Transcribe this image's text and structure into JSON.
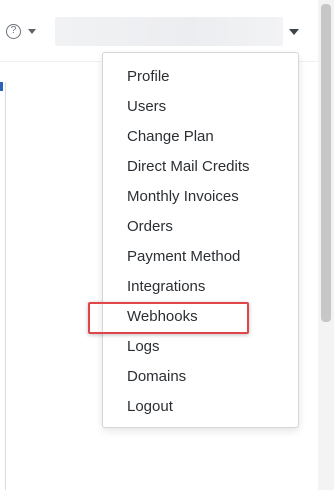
{
  "header": {
    "help": {
      "icon": "help-circle-icon",
      "glyph": "?"
    },
    "account": {
      "name": ""
    }
  },
  "account_menu": {
    "items": [
      {
        "label": "Profile"
      },
      {
        "label": "Users"
      },
      {
        "label": "Change Plan"
      },
      {
        "label": "Direct Mail Credits"
      },
      {
        "label": "Monthly Invoices"
      },
      {
        "label": "Orders"
      },
      {
        "label": "Payment Method"
      },
      {
        "label": "Integrations"
      },
      {
        "label": "Webhooks",
        "highlighted": true
      },
      {
        "label": "Logs"
      },
      {
        "label": "Domains"
      },
      {
        "label": "Logout"
      }
    ]
  },
  "colors": {
    "highlight_outline": "#e0454a",
    "menu_text": "#2b2f33",
    "link_accent": "#2a63b8"
  }
}
